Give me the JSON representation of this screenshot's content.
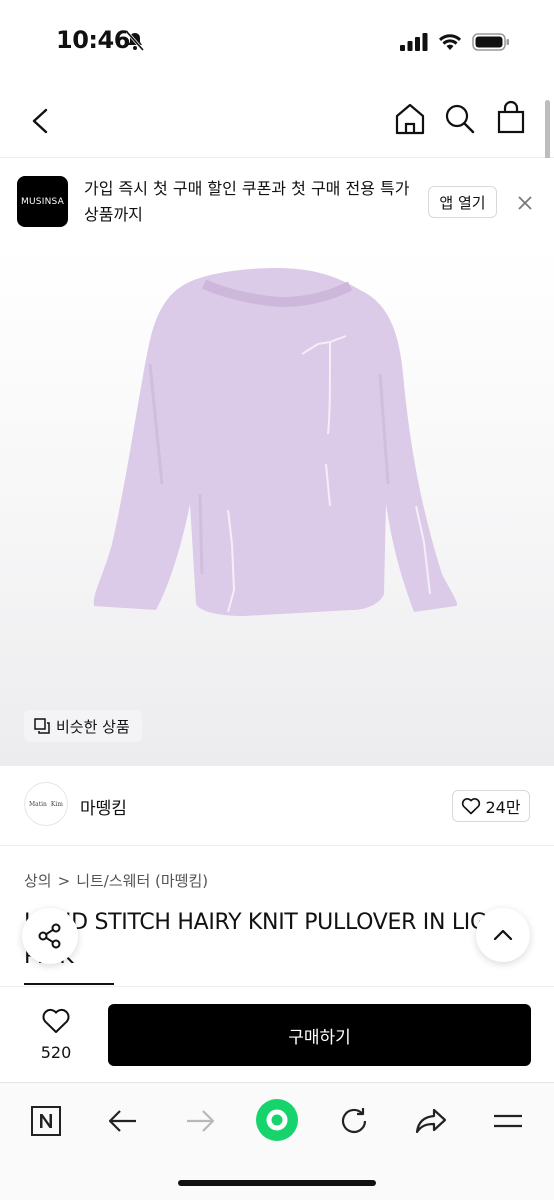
{
  "status": {
    "time": "10:46"
  },
  "nav": {
    "back": "back-icon",
    "home": "home-icon",
    "search": "search-icon",
    "bag": "bag-icon"
  },
  "promo": {
    "logo_text": "MUSINSA",
    "text": "가입 즉시 첫 구매 할인 쿠폰과 첫 구매 전용 특가 상품까지",
    "open_label": "앱 열기"
  },
  "product": {
    "similar_label": "비슷한 상품",
    "image_color": "#dfcfea"
  },
  "brand": {
    "avatar_text_1": "Matin",
    "avatar_text_2": "Kim",
    "name": "마뗑킴",
    "like_count": "24만"
  },
  "breadcrumb": {
    "level1": "상의",
    "separator": ">",
    "level2": "니트/스웨터 (마뗑킴)"
  },
  "title": "HAND STITCH HAIRY KNIT PULLOVER IN LIGHT PINK",
  "buy_bar": {
    "wish_count": "520",
    "buy_label": "구매하기"
  },
  "colors": {
    "accent": "#000000",
    "reload_green": "#16d46b"
  }
}
